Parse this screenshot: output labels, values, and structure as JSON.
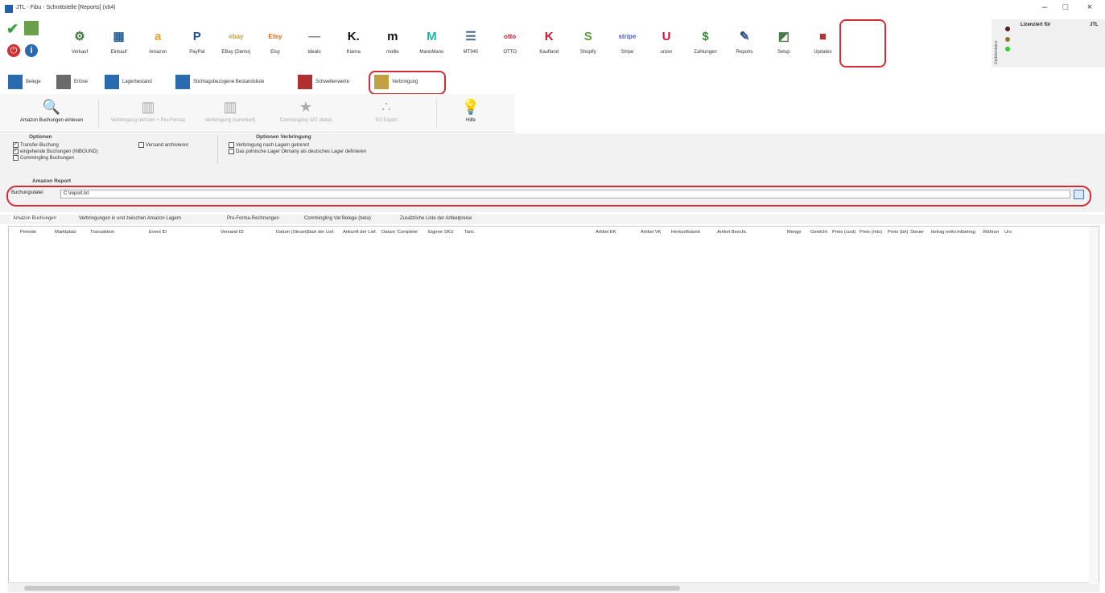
{
  "window": {
    "title": "JTL - Fibu - Schnittstelle [Reports] (x64)",
    "controls": [
      "–",
      "□",
      "×"
    ]
  },
  "ribbon": {
    "items": [
      {
        "label": "Verkauf",
        "icon": "basket-icon",
        "glyph": "⚙",
        "color": "#3a7a3a"
      },
      {
        "label": "Einkauf",
        "icon": "buildings-icon",
        "glyph": "▦",
        "color": "#2a6090"
      },
      {
        "label": "Amazon",
        "icon": "amazon-icon",
        "glyph": "a",
        "color": "#f0a030"
      },
      {
        "label": "PayPal",
        "icon": "paypal-icon",
        "glyph": "P",
        "color": "#1e4f9a"
      },
      {
        "label": "EBay (Demo)",
        "icon": "ebay-icon",
        "glyph": "ebay",
        "color": "#c0a040"
      },
      {
        "label": "Etsy",
        "icon": "etsy-icon",
        "glyph": "Etsy",
        "color": "#f1641e"
      },
      {
        "label": "Idealo",
        "icon": "idealo-icon",
        "glyph": "—",
        "color": "#888888"
      },
      {
        "label": "Klarna",
        "icon": "klarna-icon",
        "glyph": "K.",
        "color": "#111111"
      },
      {
        "label": "mollie",
        "icon": "mollie-icon",
        "glyph": "m",
        "color": "#111111"
      },
      {
        "label": "ManoMano",
        "icon": "manomano-icon",
        "glyph": "M",
        "color": "#1fb5a0"
      },
      {
        "label": "MT940",
        "icon": "mt940-icon",
        "glyph": "☰",
        "color": "#4a6a8a"
      },
      {
        "label": "OTTO",
        "icon": "otto-icon",
        "glyph": "otto",
        "color": "#d4102a"
      },
      {
        "label": "Kaufland",
        "icon": "kaufland-icon",
        "glyph": "K",
        "color": "#d4102a"
      },
      {
        "label": "Shopify",
        "icon": "shopify-icon",
        "glyph": "S",
        "color": "#5a9a3a"
      },
      {
        "label": "Stripe",
        "icon": "stripe-icon",
        "glyph": "stripe",
        "color": "#4a5ad8"
      },
      {
        "label": "unzer",
        "icon": "unzer-icon",
        "glyph": "U",
        "color": "#d4103a"
      },
      {
        "label": "Zahlungen",
        "icon": "payments-icon",
        "glyph": "$",
        "color": "#3a8a3a"
      },
      {
        "label": "Reports",
        "icon": "reports-icon",
        "glyph": "✎",
        "color": "#2a4a8a"
      },
      {
        "label": "Setup",
        "icon": "setup-icon",
        "glyph": "◩",
        "color": "#4a7a4a"
      },
      {
        "label": "Updates",
        "icon": "updates-icon",
        "glyph": "■",
        "color": "#c03030"
      }
    ],
    "license_label": "Lizenziert für",
    "license_value": "JTL",
    "status_label": "Updatestatus"
  },
  "subtabs": [
    {
      "label": "Belege",
      "icon": "receipts-icon"
    },
    {
      "label": "Erlöse",
      "icon": "revenue-icon"
    },
    {
      "label": "Lagerbestand",
      "icon": "stock-icon"
    },
    {
      "label": "Stichtagsbezogene Bestandsliste",
      "icon": "stock-list-icon"
    },
    {
      "label": "Schwellenwerte",
      "icon": "threshold-icon"
    },
    {
      "label": "Verbringung",
      "icon": "transfer-icon"
    }
  ],
  "toolbar": {
    "items": [
      {
        "label": "Amazon Buchungen einlesen",
        "icon": "import-icon",
        "glyph": "🔍",
        "enabled": true
      },
      {
        "label": "Verbringung (einzeln + Pro-Forma)",
        "icon": "transfer-single-icon",
        "glyph": "▥",
        "enabled": false
      },
      {
        "label": "Verbringung (summiert)",
        "icon": "transfer-sum-icon",
        "glyph": "▥",
        "enabled": false
      },
      {
        "label": "Commingling VAT (beta)",
        "icon": "star-icon",
        "glyph": "★",
        "enabled": false
      },
      {
        "label": "EU Export",
        "icon": "eu-export-icon",
        "glyph": "∴",
        "enabled": false
      },
      {
        "label": "Hilfe",
        "icon": "help-bulb-icon",
        "glyph": "💡",
        "enabled": true
      }
    ]
  },
  "options": {
    "title": "Optionen",
    "items": [
      {
        "label": "Transfer-Buchung",
        "checked": true
      },
      {
        "label": "eingehende Buchungen (INBOUND)",
        "checked": true
      },
      {
        "label": "Commingling Buchungen",
        "checked": false
      },
      {
        "label": "Versand archivieren",
        "checked": false
      }
    ],
    "transfer_title": "Optionen Verbringung",
    "transfer_items": [
      {
        "label": "Verbringung nach Lagern getrennt",
        "checked": false
      },
      {
        "label": "Das polnische Lager Okmany als deutsches Lager definieren",
        "checked": false
      }
    ]
  },
  "report": {
    "title": "Amazon Report",
    "file_label": "Buchungsdatei",
    "file_value": "C:\\report.txt"
  },
  "data_tabs": [
    "Amazon Buchungen",
    "Verbringungen in und zwischen Amazon Lagern",
    "Pro-Forma-Rechnungen",
    "Commingling Vat Belege (beta)",
    "Zusätzliche Liste der Artikelpreise"
  ],
  "columns": [
    "Periode",
    "Marktplatz",
    "Transaktion",
    "Event ID",
    "Versand ID",
    "Datum (Steuer)",
    "Start der Lief.",
    "Ankunft der Lief.",
    "Datum 'Complete'",
    "Eigene SKU",
    "Taric",
    "Artikel EK",
    "Artikel VK",
    "Herkunftsland",
    "Artikel Beschr.",
    "Menge",
    "Gewicht",
    "Preis (cost)",
    "Preis (mto)",
    "Preis (brt)",
    "Steuer",
    "betrag netto",
    "mtbetrag",
    "Währun",
    "Urs"
  ],
  "accent": "#d62b35"
}
